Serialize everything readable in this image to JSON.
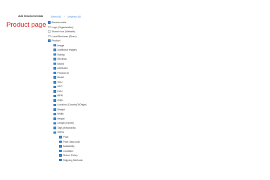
{
  "section_label": "Add Structured Data",
  "page_label": "Product page",
  "select_all": "Select All",
  "separator": "/",
  "unselect_all": "Unselect All",
  "items": [
    {
      "label": "Breadcrumbs",
      "checked": true,
      "level": 0
    },
    {
      "label": "Logo (Organization)",
      "checked": false,
      "level": 0
    },
    {
      "label": "Search box (Website)",
      "checked": false,
      "level": 0
    },
    {
      "label": "Local Business (Store)",
      "checked": false,
      "level": 0
    },
    {
      "label": "Product",
      "checked": true,
      "level": 0
    },
    {
      "label": "Image",
      "checked": true,
      "level": 1
    },
    {
      "label": "Additional images",
      "checked": true,
      "level": 1
    },
    {
      "label": "Rating",
      "checked": true,
      "level": 1
    },
    {
      "label": "Reviews",
      "checked": true,
      "level": 1
    },
    {
      "label": "Brand",
      "checked": true,
      "level": 1
    },
    {
      "label": "Attributes",
      "checked": true,
      "level": 1
    },
    {
      "label": "Product ID",
      "checked": true,
      "level": 1
    },
    {
      "label": "Model",
      "checked": true,
      "level": 1
    },
    {
      "label": "SKU",
      "checked": true,
      "level": 1
    },
    {
      "label": "UPC",
      "checked": true,
      "level": 1
    },
    {
      "label": "EAN",
      "checked": true,
      "level": 1
    },
    {
      "label": "MPN",
      "checked": true,
      "level": 1
    },
    {
      "label": "ISBN",
      "checked": true,
      "level": 1
    },
    {
      "label": "Location (CountryOfOrigin)",
      "checked": true,
      "level": 1
    },
    {
      "label": "Weight",
      "checked": true,
      "level": 1
    },
    {
      "label": "Width",
      "checked": true,
      "level": 1
    },
    {
      "label": "Height",
      "checked": true,
      "level": 1
    },
    {
      "label": "Length (Depth)",
      "checked": true,
      "level": 1
    },
    {
      "label": "Tags (Keywords)",
      "checked": true,
      "level": 1
    },
    {
      "label": "Offers",
      "checked": true,
      "level": 1
    },
    {
      "label": "Price",
      "checked": true,
      "level": 2
    },
    {
      "label": "Price Valid until",
      "checked": true,
      "level": 2
    },
    {
      "label": "Availability",
      "checked": true,
      "level": 2
    },
    {
      "label": "Condition",
      "checked": true,
      "level": 2
    },
    {
      "label": "Return Policy",
      "checked": true,
      "level": 2
    },
    {
      "label": "Shipping Methods",
      "checked": true,
      "level": 2
    }
  ]
}
